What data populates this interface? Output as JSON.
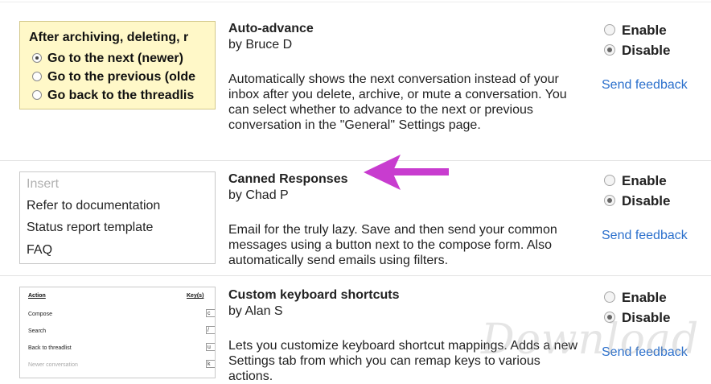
{
  "labs": [
    {
      "name": "Auto-advance",
      "author": "by Bruce D",
      "description": "Automatically shows the next conversation instead of your inbox after you delete, archive, or mute a conversation. You can select whether to advance to the next or previous conversation in the \"General\" Settings page.",
      "enable_label": "Enable",
      "disable_label": "Disable",
      "selected": "Disable",
      "feedback_label": "Send feedback",
      "preview": {
        "title": "After archiving, deleting, r",
        "options": [
          "Go to the next (newer)",
          "Go to the previous (olde",
          "Go back to the threadlis"
        ]
      }
    },
    {
      "name": "Canned Responses",
      "author": "by Chad P",
      "description": "Email for the truly lazy. Save and then send your common messages using a button next to the compose form. Also automatically send emails using filters.",
      "enable_label": "Enable",
      "disable_label": "Disable",
      "selected": "Disable",
      "feedback_label": "Send feedback",
      "preview": {
        "items": [
          "Insert",
          "Refer to documentation",
          "Status report template",
          "FAQ"
        ]
      }
    },
    {
      "name": "Custom keyboard shortcuts",
      "author": "by Alan S",
      "description": "Lets you customize keyboard shortcut mappings. Adds a new Settings tab from which you can remap keys to various actions.",
      "enable_label": "Enable",
      "disable_label": "Disable",
      "selected": "Disable",
      "feedback_label": "Send feedback",
      "preview": {
        "col_action": "Action",
        "col_keys": "Key(s)",
        "rows": [
          {
            "action": "Compose",
            "key": "c"
          },
          {
            "action": "Search",
            "key": "/"
          },
          {
            "action": "Back to threadlist",
            "key": "u"
          },
          {
            "action": "Newer conversation",
            "key": "k"
          }
        ]
      }
    }
  ],
  "watermark": "Download",
  "colors": {
    "link": "#2a6fcc",
    "arrow": "#c83ccf",
    "thumb_yellow": "#fff8c8"
  }
}
